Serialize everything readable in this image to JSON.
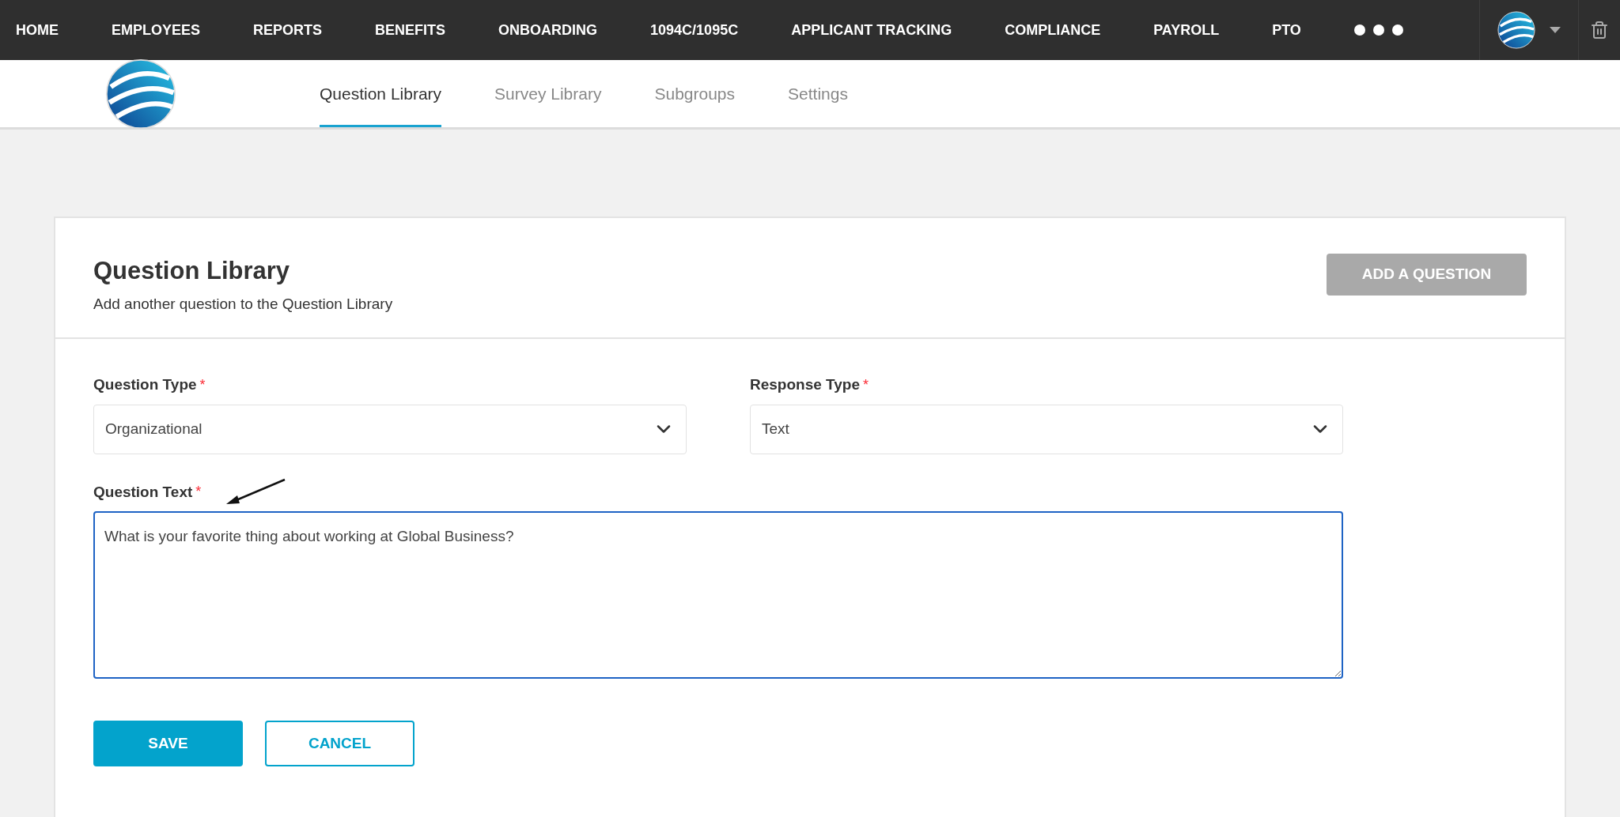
{
  "top_nav": {
    "items": [
      {
        "label": "HOME"
      },
      {
        "label": "EMPLOYEES"
      },
      {
        "label": "REPORTS"
      },
      {
        "label": "BENEFITS"
      },
      {
        "label": "ONBOARDING"
      },
      {
        "label": "1094C/1095C"
      },
      {
        "label": "APPLICANT TRACKING"
      },
      {
        "label": "COMPLIANCE"
      },
      {
        "label": "PAYROLL"
      },
      {
        "label": "PTO"
      }
    ]
  },
  "tabs": [
    {
      "label": "Question Library",
      "selected": true
    },
    {
      "label": "Survey Library",
      "selected": false
    },
    {
      "label": "Subgroups",
      "selected": false
    },
    {
      "label": "Settings",
      "selected": false
    }
  ],
  "card": {
    "title": "Question Library",
    "subtitle": "Add another question to the Question Library",
    "add_button": {
      "label": "ADD A QUESTION",
      "disabled": true
    }
  },
  "form": {
    "question_type": {
      "label": "Question Type",
      "required": true,
      "required_mark": "*",
      "value": "Organizational"
    },
    "response_type": {
      "label": "Response Type",
      "required": true,
      "required_mark": "*",
      "value": "Text"
    },
    "question_text": {
      "label": "Question Text",
      "required": true,
      "required_mark": "*",
      "value": "What is your favorite thing about working at Global Business?"
    }
  },
  "buttons": [
    {
      "kind": "primary",
      "label": "SAVE"
    },
    {
      "kind": "secondary",
      "label": "CANCEL"
    }
  ]
}
